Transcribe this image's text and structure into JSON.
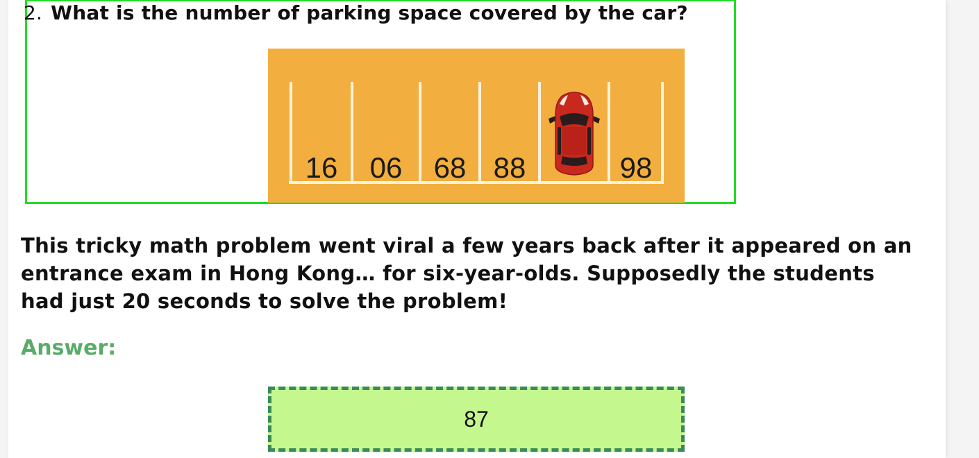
{
  "question": {
    "number": "2.",
    "text": "What is the number of parking space covered by the car?"
  },
  "puzzle": {
    "spaces": [
      "16",
      "06",
      "68",
      "88",
      "",
      "98"
    ],
    "car_space_index": 4,
    "colors": {
      "background": "#f2ae3e",
      "lines": "#fdf3dc",
      "car": "#c8281e"
    }
  },
  "paragraph": "This tricky math problem went viral a few years back after it appeared on an entrance exam in Hong Kong… for six-year-olds. Supposedly the students had just 20 seconds to solve the problem!",
  "answer": {
    "label": "Answer:",
    "value": "87",
    "colors": {
      "label": "#5aab6a",
      "box_fill": "#c5f78f",
      "box_border": "#3a8a5c"
    }
  },
  "highlight_color": "#22dd22"
}
